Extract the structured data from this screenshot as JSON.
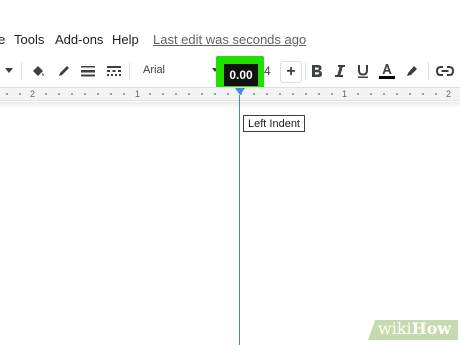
{
  "menu": {
    "items": [
      {
        "label": "e"
      },
      {
        "label": "Tools"
      },
      {
        "label": "Add-ons"
      },
      {
        "label": "Help"
      }
    ],
    "last_edit": "Last edit was seconds ago"
  },
  "toolbar": {
    "font_name": "Arial",
    "font_size": "0.00",
    "font_size_behind": "4",
    "plus_label": "+",
    "icons": [
      "caret-down-icon",
      "paint-bucket-icon",
      "pencil-icon",
      "border-weight-icon",
      "border-dash-icon",
      "bold-icon",
      "italic-icon",
      "underline-icon",
      "text-color-icon",
      "highlight-icon",
      "link-icon"
    ],
    "highlight_color": "#1fe000"
  },
  "ruler": {
    "labels": [
      "2",
      "1",
      "1",
      "2"
    ]
  },
  "tooltip": "Left Indent",
  "watermark": {
    "prefix": "wiki",
    "suffix": "How"
  },
  "colors": {
    "accent_blue": "#4285f4",
    "text_color_bar": "#000000"
  }
}
